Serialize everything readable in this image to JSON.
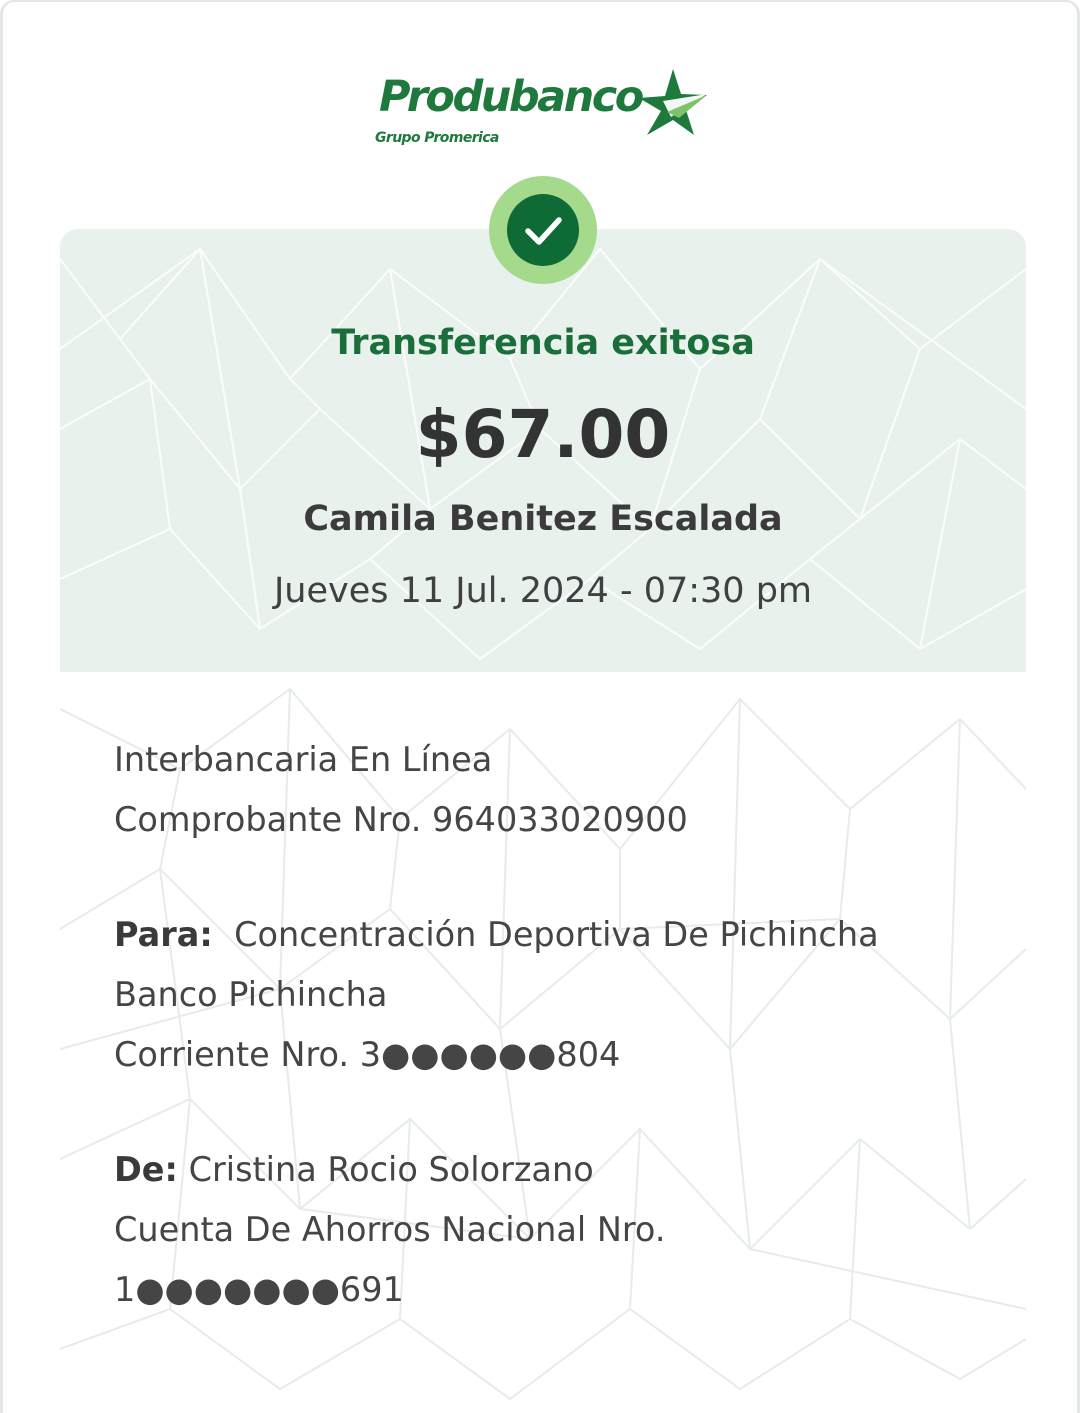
{
  "logo": {
    "name": "Produbanco",
    "subtitle": "Grupo Promerica",
    "color": "#1e7a3c"
  },
  "status": {
    "icon": "check-circle-icon",
    "title": "Transferencia exitosa",
    "title_color": "#1a6e3a",
    "badge_color": "#a5d98c",
    "badge_inner_color": "#0f6b35"
  },
  "transfer": {
    "amount": "$67.00",
    "recipient_name": "Camila Benitez Escalada",
    "datetime": "Jueves 11 Jul. 2024 - 07:30 pm",
    "type": "Interbancaria En Línea",
    "receipt": "Comprobante Nro. 964033020900"
  },
  "to": {
    "label": "Para:",
    "name": "Concentración Deportiva De Pichincha",
    "bank": "Banco Pichincha",
    "account": "Corriente Nro. 3●●●●●●804"
  },
  "from": {
    "label": "De:",
    "name": "Cristina Rocio Solorzano",
    "account_type": "Cuenta De Ahorros Nacional Nro.",
    "account_number": "1●●●●●●●691"
  }
}
